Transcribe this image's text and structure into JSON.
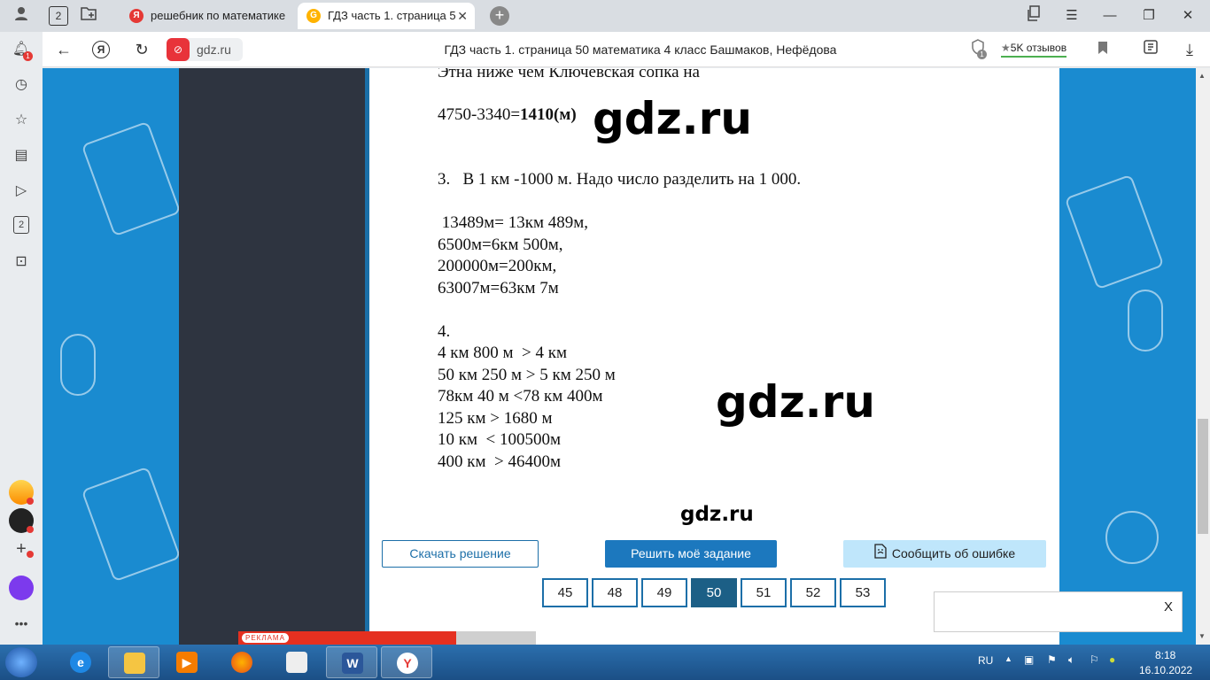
{
  "tabs": [
    {
      "title": "решебник по математике",
      "favicon": "Я"
    },
    {
      "title": "ГДЗ часть 1. страница 5",
      "favicon": "G"
    }
  ],
  "tabbar": {
    "tab_count": "2"
  },
  "navbar": {
    "host": "gdz.ru",
    "page_title": "ГДЗ часть 1. страница 50 математика 4 класс Башмаков, Нефёдова",
    "reviews": "5K отзывов",
    "protect_count": "1"
  },
  "sidebar": {
    "notifications": "1",
    "counter": "2"
  },
  "solution": {
    "line1": "Этна ниже чем Ключевская сопка на",
    "line2_expr": "4750-3340=",
    "line2_bold": "1410(м)",
    "task3": "3.   В 1 км -1000 м. Надо число разделить на 1 000.",
    "t3_rows": [
      " 13489м= 13км 489м,",
      "6500м=6км 500м,",
      "200000м=200км,",
      "63007м=63км 7м"
    ],
    "task4": "4.",
    "t4_rows": [
      "4 км 800 м  > 4 км",
      "50 км 250 м > 5 км 250 м",
      "78км 40 м <78 км 400м",
      "125 км > 1680 м",
      "10 км  < 100500м",
      "400 км  > 46400м"
    ]
  },
  "watermarks": {
    "top": "gdz.ru",
    "middle": "gdz.ru",
    "bottom": "gdz.ru"
  },
  "actions": {
    "download": "Скачать решение",
    "solve": "Решить моё задание",
    "report": "Сообщить об ошибке"
  },
  "pagination": [
    {
      "label": "45",
      "current": false
    },
    {
      "label": "48",
      "current": false
    },
    {
      "label": "49",
      "current": false
    },
    {
      "label": "50",
      "current": true
    },
    {
      "label": "51",
      "current": false
    },
    {
      "label": "52",
      "current": false
    },
    {
      "label": "53",
      "current": false
    }
  ],
  "ad": {
    "label": "РЕКЛАМА"
  },
  "popup": {
    "close": "X"
  },
  "taskbar": {
    "lang": "RU",
    "time": "8:18",
    "date": "16.10.2022",
    "apps": [
      "ie-icon",
      "explorer-icon",
      "media-icon",
      "firefox-icon",
      "notepad-icon",
      "word-icon",
      "yandex-icon"
    ]
  },
  "colors": {
    "accent": "#1c78be",
    "background": "#1a8bd0",
    "dark_panel": "#2e3440"
  }
}
